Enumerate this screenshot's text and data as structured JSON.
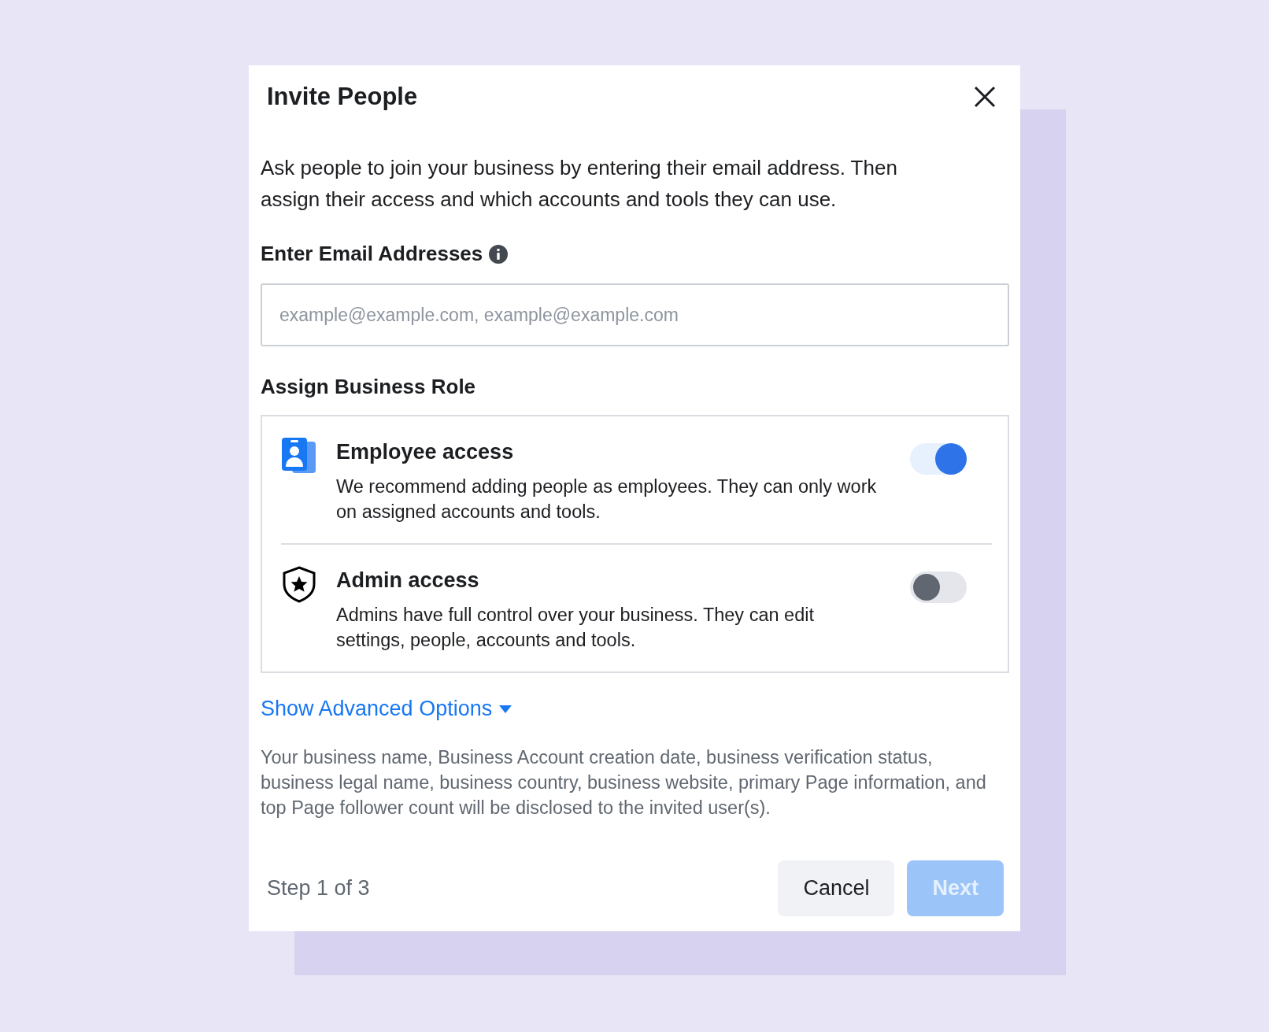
{
  "dialog": {
    "title": "Invite People",
    "intro": "Ask people to join your business by entering their email address. Then assign their access and which accounts and tools they can use."
  },
  "email": {
    "label": "Enter Email Addresses",
    "placeholder": "example@example.com, example@example.com"
  },
  "roles_heading": "Assign Business Role",
  "roles": [
    {
      "kind": "employee",
      "title": "Employee access",
      "description": "We recommend adding people as employees. They can only work on assigned accounts and tools.",
      "on": true
    },
    {
      "kind": "admin",
      "title": "Admin access",
      "description": "Admins have full control over your business. They can edit settings, people, accounts and tools.",
      "on": false
    }
  ],
  "advanced_link": "Show Advanced Options",
  "disclaimer": "Your business name, Business Account creation date, business verification status, business legal name, business country, business website, primary Page information, and top Page follower count will be disclosed to the invited user(s).",
  "footer": {
    "step": "Step 1 of 3",
    "buttons": [
      {
        "label": "Cancel",
        "kind": "secondary",
        "disabled": false
      },
      {
        "label": "Next",
        "kind": "primary",
        "disabled": true
      }
    ]
  }
}
